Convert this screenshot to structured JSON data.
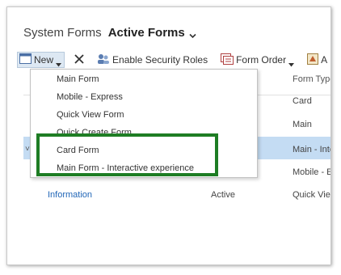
{
  "header": {
    "prefix": "System Forms",
    "view_name": "Active Forms"
  },
  "toolbar": {
    "new_label": "New",
    "security_label": "Enable Security Roles",
    "form_order_label": "Form Order",
    "truncated_label": "A"
  },
  "grid": {
    "column_form_type": "Form Type",
    "rows": [
      {
        "name": "",
        "state": "",
        "type": "Card"
      },
      {
        "name": "",
        "state": "",
        "type": "Main"
      },
      {
        "name": "",
        "state": "",
        "type": "Main - Inte"
      },
      {
        "name": "",
        "state": "",
        "type": "Mobile - E"
      },
      {
        "name": "Information",
        "state": "Active",
        "type": "Quick View"
      }
    ],
    "row_marker": "˅"
  },
  "new_menu": {
    "items": [
      "Main Form",
      "Mobile - Express",
      "Quick View Form",
      "Quick Create Form",
      "Card Form",
      "Main Form - Interactive experience"
    ]
  },
  "colors": {
    "accent_link": "#2166b7",
    "row_selected": "#c4dcf3",
    "highlight_box": "#1e7d24",
    "new_button_bg": "#dde8f3"
  },
  "icons": [
    "chevron-down-icon",
    "new-form-icon",
    "caret-down-icon",
    "delete-x-icon",
    "security-roles-icon",
    "form-order-icon"
  ]
}
